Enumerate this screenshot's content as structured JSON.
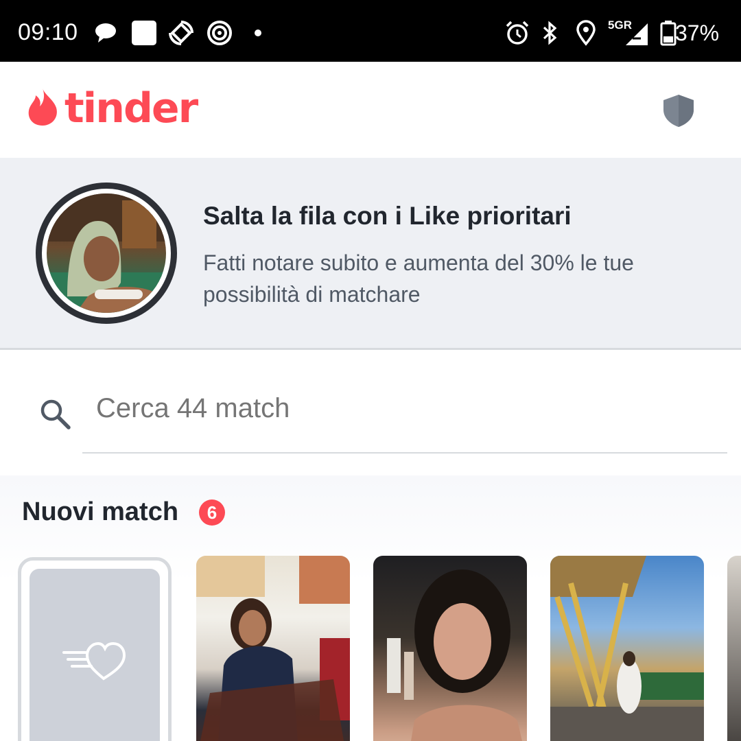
{
  "status_bar": {
    "time": "09:10",
    "network": "5G",
    "signal_sub": "R",
    "battery_percent": "37%",
    "icons": [
      "chat-bubble-icon",
      "square-notification-icon",
      "rotate-icon",
      "target-icon",
      "dot-icon",
      "alarm-icon",
      "bluetooth-icon",
      "location-icon",
      "signal-icon",
      "battery-icon"
    ]
  },
  "header": {
    "logo_text": "tinder",
    "brand_color": "#fd4a55",
    "shield_color": "#7c8591"
  },
  "promo": {
    "title": "Salta la fila con i Like prioritari",
    "subtitle": "Fatti notare subito e aumenta del 30% le tue possibilità di matchare"
  },
  "search": {
    "placeholder": "Cerca 44 match"
  },
  "new_matches": {
    "title": "Nuovi match",
    "count": "6",
    "cards": [
      {
        "kind": "likes",
        "icon": "heart-speed-icon"
      },
      {
        "kind": "photo"
      },
      {
        "kind": "photo"
      },
      {
        "kind": "photo"
      },
      {
        "kind": "photo"
      }
    ]
  }
}
